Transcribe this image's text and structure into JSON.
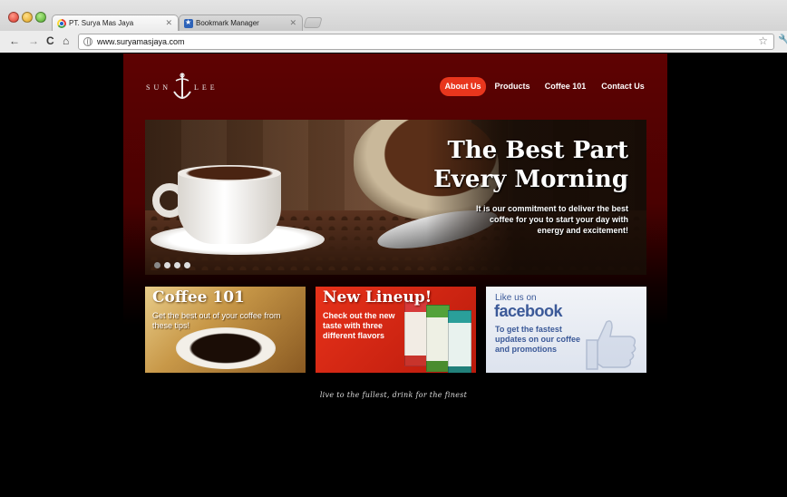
{
  "browser": {
    "tabs": [
      {
        "title": "PT. Surya Mas Jaya",
        "active": true,
        "favicon": "chrome-icon"
      },
      {
        "title": "Bookmark Manager",
        "active": false,
        "favicon": "bookmark-icon"
      }
    ],
    "url": "www.suryamasjaya.com"
  },
  "site": {
    "logo": {
      "left": "SUN",
      "right": "LEE"
    },
    "nav": [
      "About Us",
      "Products",
      "Coffee 101",
      "Contact Us"
    ],
    "nav_active": "About Us",
    "hero": {
      "title_line1": "The Best Part",
      "title_line2": "Every Morning",
      "body": "It is our commitment to deliver the best coffee for you to start your day with energy and excitement!",
      "slide_count": 4,
      "active_slide": 1
    },
    "promos": {
      "coffee101": {
        "title": "Coffee 101",
        "text": "Get the best out of your coffee from these tips!"
      },
      "lineup": {
        "title": "New Lineup!",
        "text": "Check out the new taste with three different flavors"
      },
      "facebook": {
        "like": "Like us on",
        "brand": "facebook",
        "text": "To get the fastest updates on our coffee and promotions"
      }
    },
    "tagline": "live to the fullest, drink for the finest"
  },
  "colors": {
    "header_bg": "#5e0202",
    "nav_active_bg": "#e8361d",
    "facebook_blue": "#3b5998",
    "lineup_red": "#e8321a"
  }
}
